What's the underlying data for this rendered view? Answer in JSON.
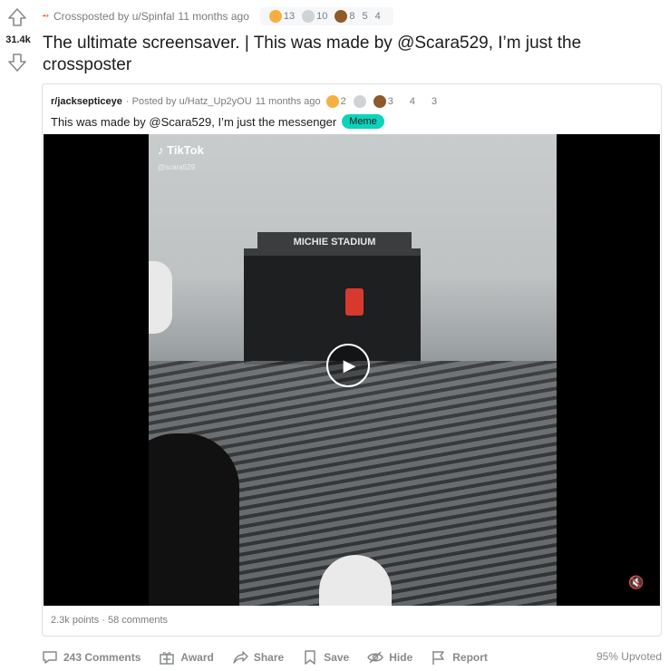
{
  "post": {
    "score": "31.4k",
    "crosspost_label": "Crossposted by u/Spinfal",
    "time": "11 months ago",
    "awards": [
      {
        "icon": "helpful-award-icon",
        "count": "13",
        "color": "#f5b041"
      },
      {
        "icon": "wholesome-award-icon",
        "count": "10",
        "color": "#d0d3d4"
      },
      {
        "icon": "bear-award-icon",
        "count": "8",
        "color": "#8e5a2a"
      },
      {
        "icon": "award-icon",
        "count": "5",
        "color": "#f6f7f8"
      },
      {
        "icon": "award-icon",
        "count": "4",
        "color": "#f6f7f8"
      }
    ],
    "title": "The ultimate screensaver. | This was made by @Scara529, I’m just the crossposter"
  },
  "crosspost": {
    "subreddit": "r/jacksepticeye",
    "posted_by": "· Posted by u/Hatz_Up2yOU",
    "time": "11 months ago",
    "awards": [
      {
        "icon": "helpful-award-icon",
        "count": "2",
        "color": "#f5b041"
      },
      {
        "icon": "wholesome-award-icon",
        "count": "",
        "color": "#d0d3d4"
      },
      {
        "icon": "bear-award-icon",
        "count": "3",
        "color": "#8e5a2a"
      },
      {
        "icon": "award-icon",
        "count": "4",
        "color": "#ffffff"
      },
      {
        "icon": "award-icon",
        "count": "3",
        "color": "#ffffff"
      }
    ],
    "title": "This was made by @Scara529, I’m just the messenger",
    "flair": "Meme",
    "flair_color": "#0dd3bb",
    "video": {
      "tiktok_label": "TikTok",
      "tiktok_handle": "@scara529",
      "stadium_sign": "MICHIE STADIUM"
    },
    "footer": "2.3k points · 58 comments"
  },
  "actions": {
    "comments": "243 Comments",
    "award": "Award",
    "share": "Share",
    "save": "Save",
    "hide": "Hide",
    "report": "Report"
  },
  "upvoted": "95% Upvoted"
}
